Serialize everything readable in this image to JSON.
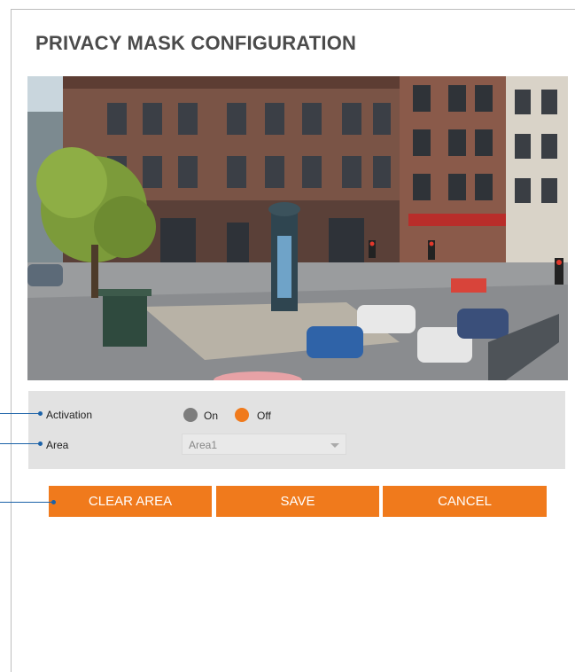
{
  "page": {
    "title": "PRIVACY MASK CONFIGURATION"
  },
  "form": {
    "activation": {
      "label": "Activation",
      "options": [
        "On",
        "Off"
      ],
      "selected": "Off"
    },
    "area": {
      "label": "Area",
      "value": "Area1"
    }
  },
  "buttons": {
    "clear_area": "CLEAR AREA",
    "save": "SAVE",
    "cancel": "CANCEL"
  },
  "colors": {
    "accent": "#f07a1c",
    "callout_line": "#1b62a8",
    "panel_bg": "#e2e2e2"
  },
  "icons": {
    "radio_unselected": "radio-gray-circle",
    "radio_selected": "radio-orange-circle",
    "dropdown": "chevron-down-icon"
  }
}
